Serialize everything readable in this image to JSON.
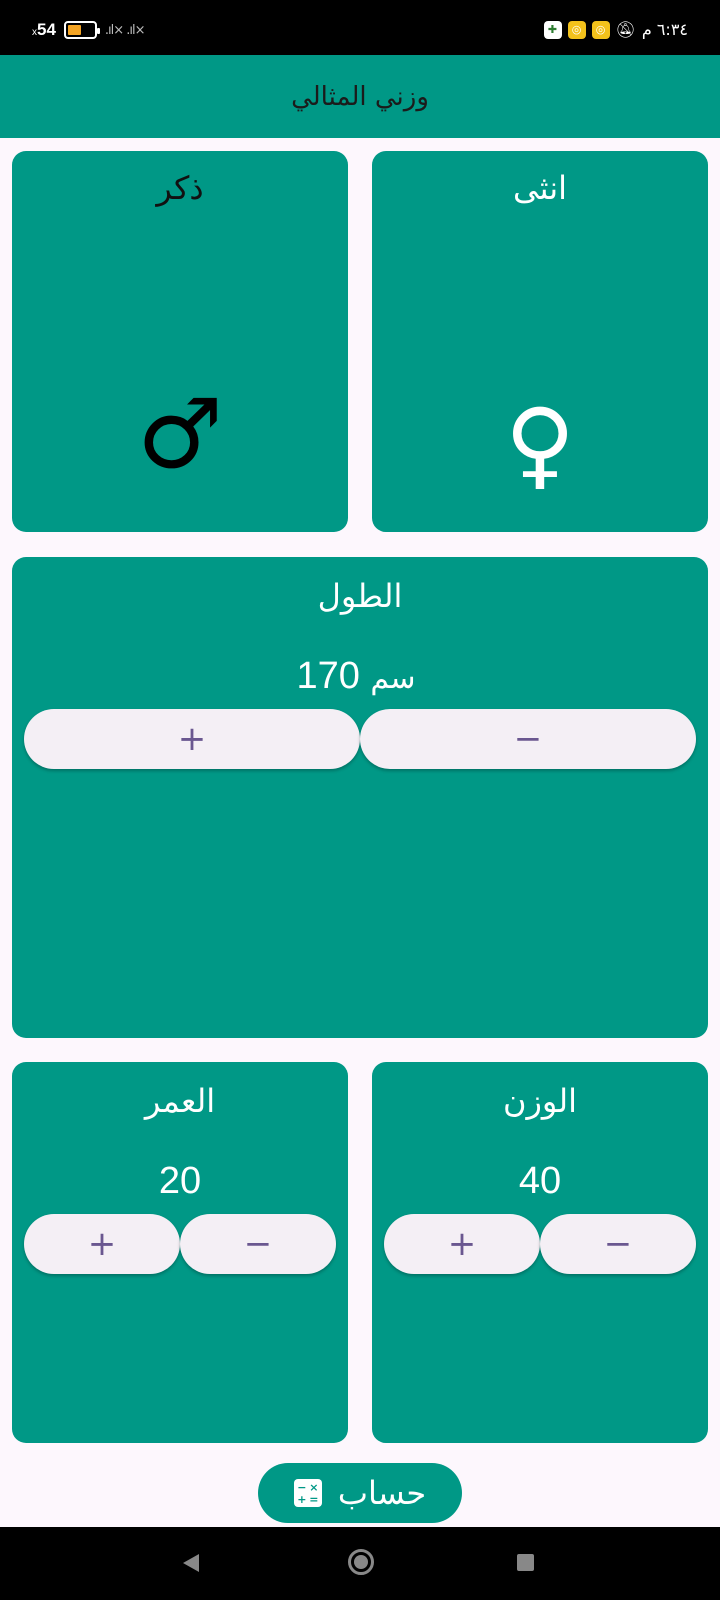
{
  "status_bar": {
    "battery_text": "54",
    "battery_small": "x",
    "battery_level": 0.54,
    "signal": ".ıl× .ıl×",
    "clock": "٦:٣٤ م"
  },
  "app_bar": {
    "title": "وزني المثالي"
  },
  "gender": {
    "male": {
      "label": "ذكر",
      "symbol": "♂"
    },
    "female": {
      "label": "انثى",
      "symbol": "♀"
    }
  },
  "height": {
    "label": "الطول",
    "value": "170",
    "unit": "سم",
    "plus": "+",
    "minus": "−"
  },
  "age": {
    "label": "العمر",
    "value": "20",
    "plus": "+",
    "minus": "−"
  },
  "weight": {
    "label": "الوزن",
    "value": "40",
    "plus": "+",
    "minus": "−"
  },
  "calculate": {
    "label": "حساب",
    "icon_glyphs": [
      "−",
      "×",
      "+",
      "="
    ]
  },
  "colors": {
    "primary": "#009886",
    "background": "#fdf7fd",
    "pill": "#f4eff5",
    "pill_text": "#6a5790"
  }
}
